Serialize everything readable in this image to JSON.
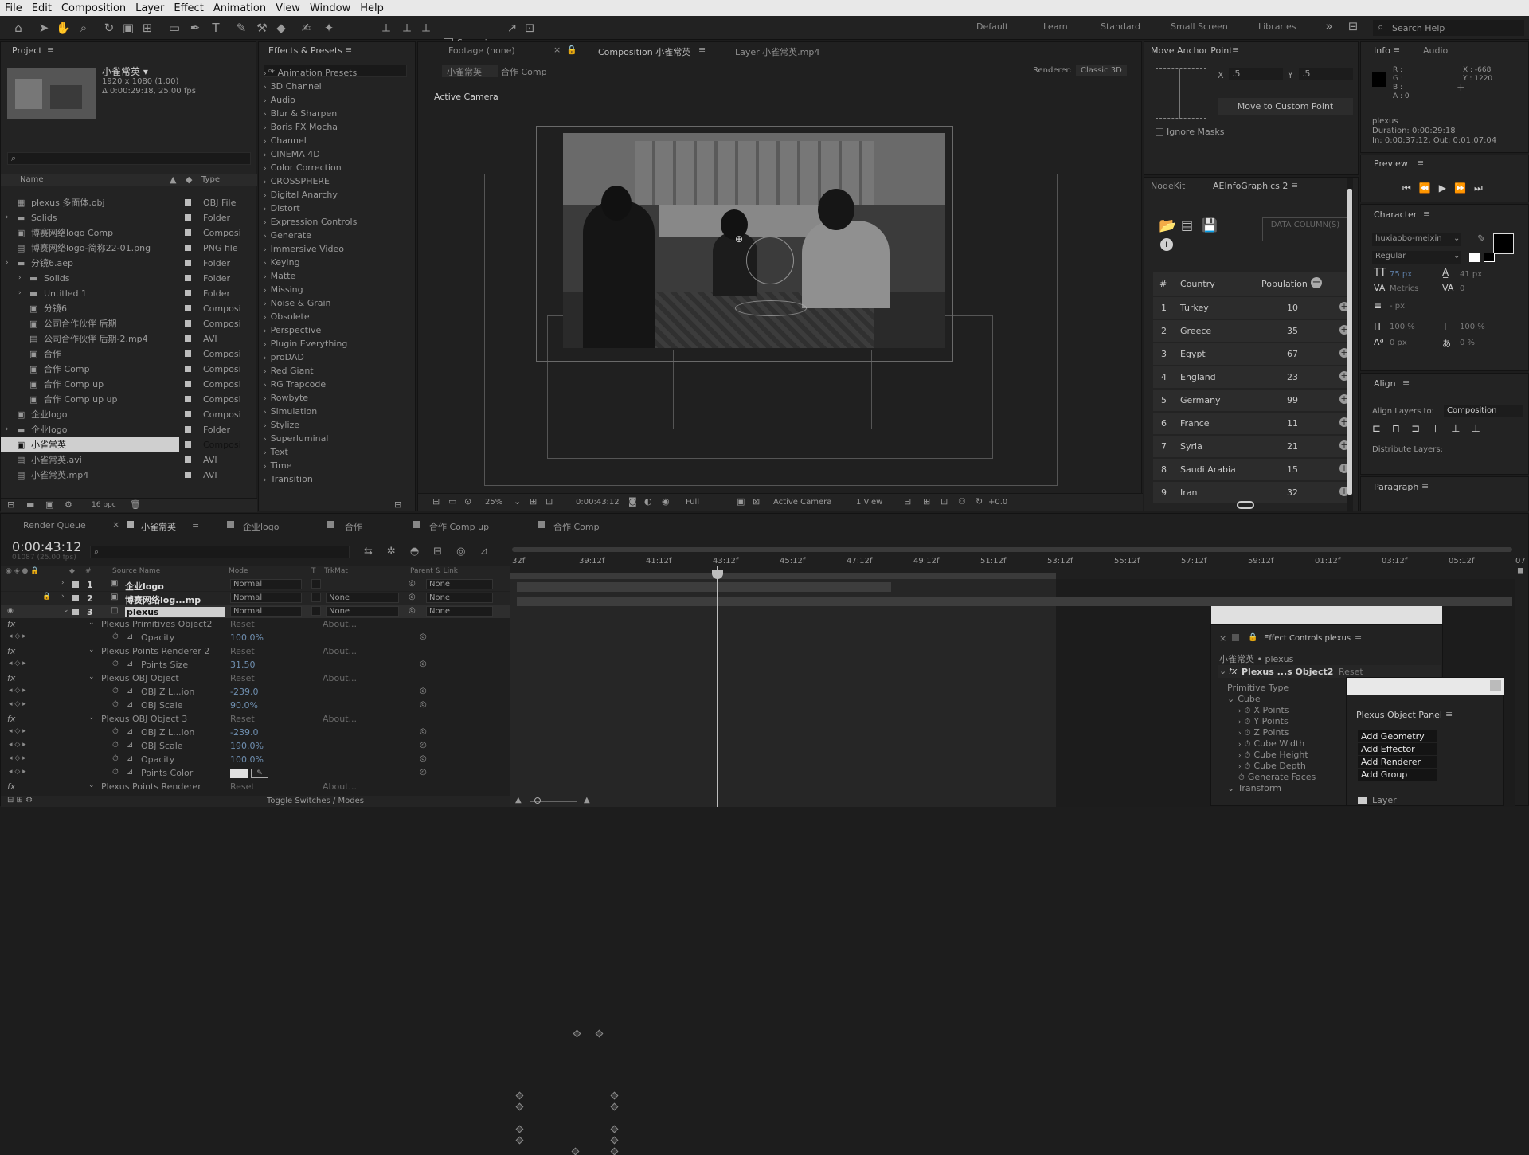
{
  "menu": [
    "File",
    "Edit",
    "Composition",
    "Layer",
    "Effect",
    "Animation",
    "View",
    "Window",
    "Help"
  ],
  "toolbar": {
    "snapping": "Snapping",
    "workspaces": [
      "Default",
      "Learn",
      "Standard",
      "Small Screen",
      "Libraries"
    ],
    "search_help": "Search Help"
  },
  "project": {
    "tab": "Project",
    "comp_name": "小雀常英 ▾",
    "comp_info": [
      "1920 x 1080 (1.00)",
      "Δ 0:00:29:18, 25.00 fps"
    ],
    "col_name": "Name",
    "col_type": "Type",
    "items": [
      {
        "name": "plexus 多面体.obj",
        "type": "OBJ File",
        "indent": 0,
        "icon": "obj"
      },
      {
        "name": "Solids",
        "type": "Folder",
        "indent": 0,
        "icon": "folder"
      },
      {
        "name": "博赛网络logo Comp",
        "type": "Composi",
        "indent": 0,
        "icon": "comp"
      },
      {
        "name": "博赛网络logo-简称22-01.png",
        "type": "PNG file",
        "indent": 0,
        "icon": "file"
      },
      {
        "name": "分镜6.aep",
        "type": "Folder",
        "indent": 0,
        "icon": "folder"
      },
      {
        "name": "Solids",
        "type": "Folder",
        "indent": 1,
        "icon": "folder"
      },
      {
        "name": "Untitled 1",
        "type": "Folder",
        "indent": 1,
        "icon": "folder"
      },
      {
        "name": "分镜6",
        "type": "Composi",
        "indent": 1,
        "icon": "comp"
      },
      {
        "name": "公司合作伙伴  后期",
        "type": "Composi",
        "indent": 1,
        "icon": "comp"
      },
      {
        "name": "公司合作伙伴  后期-2.mp4",
        "type": "AVI",
        "indent": 1,
        "icon": "file"
      },
      {
        "name": "合作",
        "type": "Composi",
        "indent": 1,
        "icon": "comp"
      },
      {
        "name": "合作 Comp",
        "type": "Composi",
        "indent": 1,
        "icon": "comp"
      },
      {
        "name": "合作 Comp up",
        "type": "Composi",
        "indent": 1,
        "icon": "comp"
      },
      {
        "name": "合作 Comp up  up",
        "type": "Composi",
        "indent": 1,
        "icon": "comp"
      },
      {
        "name": "企业logo",
        "type": "Composi",
        "indent": 0,
        "icon": "comp"
      },
      {
        "name": "企业logo",
        "type": "Folder",
        "indent": 0,
        "icon": "folder"
      },
      {
        "name": "小雀常英",
        "type": "Composi",
        "indent": 0,
        "icon": "comp"
      },
      {
        "name": "小雀常英.avi",
        "type": "AVI",
        "indent": 0,
        "icon": "file"
      },
      {
        "name": "小雀常英.mp4",
        "type": "AVI",
        "indent": 0,
        "icon": "file"
      }
    ],
    "bpc": "16 bpc"
  },
  "effects": {
    "tab": "Effects & Presets",
    "items": [
      "* Animation Presets",
      "3D Channel",
      "Audio",
      "Blur & Sharpen",
      "Boris FX Mocha",
      "Channel",
      "CINEMA 4D",
      "Color Correction",
      "CROSSPHERE",
      "Digital Anarchy",
      "Distort",
      "Expression Controls",
      "Generate",
      "Immersive Video",
      "Keying",
      "Matte",
      "Missing",
      "Noise & Grain",
      "Obsolete",
      "Perspective",
      "Plugin Everything",
      "proDAD",
      "Red Giant",
      "RG Trapcode",
      "Rowbyte",
      "Simulation",
      "Stylize",
      "Superluminal",
      "Text",
      "Time",
      "Transition"
    ]
  },
  "viewer": {
    "tab_footage": "Footage (none)",
    "tab_comp": "Composition 小雀常英",
    "tab_layer": "Layer 小雀常英.mp4",
    "crumb1": "小雀常英",
    "crumb2": "合作 Comp",
    "renderer_label": "Renderer:",
    "renderer": "Classic 3D",
    "active_camera": "Active Camera",
    "zoom": "25%",
    "timecode": "0:00:43:12",
    "resolution": "Full",
    "camera": "Active Camera",
    "views": "1 View",
    "exposure": "+0.0"
  },
  "anchor": {
    "tab": "Move Anchor Point",
    "x_label": "X",
    "x": ".5",
    "y_label": "Y",
    "y": ".5",
    "button": "Move to Custom Point",
    "ignore": "Ignore Masks"
  },
  "info": {
    "tab": "Info",
    "tab2": "Audio",
    "rgba": [
      "R :",
      "G :",
      "B :",
      "A : 0"
    ],
    "xy": [
      "X : -668",
      "Y : 1220"
    ],
    "layer": "plexus",
    "duration": "Duration: 0:00:29:18",
    "inout": "In: 0:00:37:12, Out: 0:01:07:04"
  },
  "preview": {
    "tab": "Preview"
  },
  "nodekit": {
    "tab1": "NodeKit",
    "tab2": "AEInfoGraphics 2",
    "data_btn": "DATA COLUMN(S)",
    "h_num": "#",
    "h_country": "Country",
    "h_pop": "Population",
    "rows": [
      {
        "n": "1",
        "country": "Turkey",
        "pop": "10"
      },
      {
        "n": "2",
        "country": "Greece",
        "pop": "35"
      },
      {
        "n": "3",
        "country": "Egypt",
        "pop": "67"
      },
      {
        "n": "4",
        "country": "England",
        "pop": "23"
      },
      {
        "n": "5",
        "country": "Germany",
        "pop": "99"
      },
      {
        "n": "6",
        "country": "France",
        "pop": "11"
      },
      {
        "n": "7",
        "country": "Syria",
        "pop": "21"
      },
      {
        "n": "8",
        "country": "Saudi Arabia",
        "pop": "15"
      },
      {
        "n": "9",
        "country": "Iran",
        "pop": "32"
      }
    ]
  },
  "character": {
    "tab": "Character",
    "font": "huxiaobo-meixin",
    "style": "Regular",
    "size": "75 px",
    "leading": "41 px",
    "metrics": "Metrics",
    "tracking": "0",
    "stroke": "- px",
    "vscale": "100 %",
    "hscale": "100 %",
    "baseline": "0 px",
    "tsume": "0 %"
  },
  "align": {
    "tab": "Align",
    "align_to_label": "Align Layers to:",
    "align_to": "Composition",
    "distribute": "Distribute Layers:"
  },
  "paragraph": {
    "tab": "Paragraph"
  },
  "timeline": {
    "render_queue": "Render Queue",
    "tabs": [
      "小雀常英",
      "企业logo",
      "合作",
      "合作 Comp up",
      "合作 Comp"
    ],
    "timecode": "0:00:43:12",
    "timecode_sub": "01087 (25.00 fps)",
    "col_num": "#",
    "col_source": "Source Name",
    "col_mode": "Mode",
    "col_t": "T",
    "col_trkmat": "TrkMat",
    "col_parent": "Parent & Link",
    "ruler": [
      "32f",
      "39:12f",
      "41:12f",
      "43:12f",
      "45:12f",
      "47:12f",
      "49:12f",
      "51:12f",
      "53:12f",
      "55:12f",
      "57:12f",
      "59:12f",
      "01:12f",
      "03:12f",
      "05:12f",
      "07"
    ],
    "layers": [
      {
        "num": "1",
        "name": "企业logo",
        "mode": "Normal",
        "trkmat": "",
        "parent": "None"
      },
      {
        "num": "2",
        "name": "博赛网络log...mp",
        "mode": "Normal",
        "trkmat": "None",
        "parent": "None"
      },
      {
        "num": "3",
        "name": "plexus",
        "mode": "Normal",
        "trkmat": "None",
        "parent": "None"
      }
    ],
    "props": [
      {
        "label": "Plexus Primitives Object2",
        "val": "Reset",
        "extra": "About...",
        "level": 1,
        "fx": true
      },
      {
        "label": "Opacity",
        "val": "100.0%",
        "level": 2
      },
      {
        "label": "Plexus Points Renderer 2",
        "val": "Reset",
        "extra": "About...",
        "level": 1,
        "fx": true
      },
      {
        "label": "Points Size",
        "val": "31.50",
        "level": 2
      },
      {
        "label": "Plexus OBJ Object",
        "val": "Reset",
        "extra": "About...",
        "level": 1,
        "fx": true
      },
      {
        "label": "OBJ Z L...ion",
        "val": "-239.0",
        "level": 2
      },
      {
        "label": "OBJ Scale",
        "val": "90.0%",
        "level": 2
      },
      {
        "label": "Plexus OBJ Object 3",
        "val": "Reset",
        "extra": "About...",
        "level": 1,
        "fx": true
      },
      {
        "label": "OBJ Z L...ion",
        "val": "-239.0",
        "level": 2
      },
      {
        "label": "OBJ Scale",
        "val": "190.0%",
        "level": 2
      },
      {
        "label": "Opacity",
        "val": "100.0%",
        "level": 2
      },
      {
        "label": "Points Color",
        "val": "",
        "level": 2
      },
      {
        "label": "Plexus Points Renderer",
        "val": "Reset",
        "extra": "About...",
        "level": 1,
        "fx": true
      }
    ],
    "toggle": "Toggle Switches / Modes"
  },
  "effect_controls": {
    "tab": "Effect Controls plexus",
    "path": "小雀常英 • plexus",
    "effect": "Plexus ...s Object2",
    "reset": "Reset",
    "items": [
      "Primitive Type",
      "Cube",
      "X Points",
      "Y Points",
      "Z Points",
      "Cube Width",
      "Cube Height",
      "Cube Depth",
      "Generate Faces",
      "Transform"
    ]
  },
  "plexus_panel": {
    "title": "Plexus Object Panel",
    "items": [
      "Add Geometry",
      "Add Effector",
      "Add Renderer",
      "Add Group"
    ],
    "layer_label": "Layer"
  }
}
